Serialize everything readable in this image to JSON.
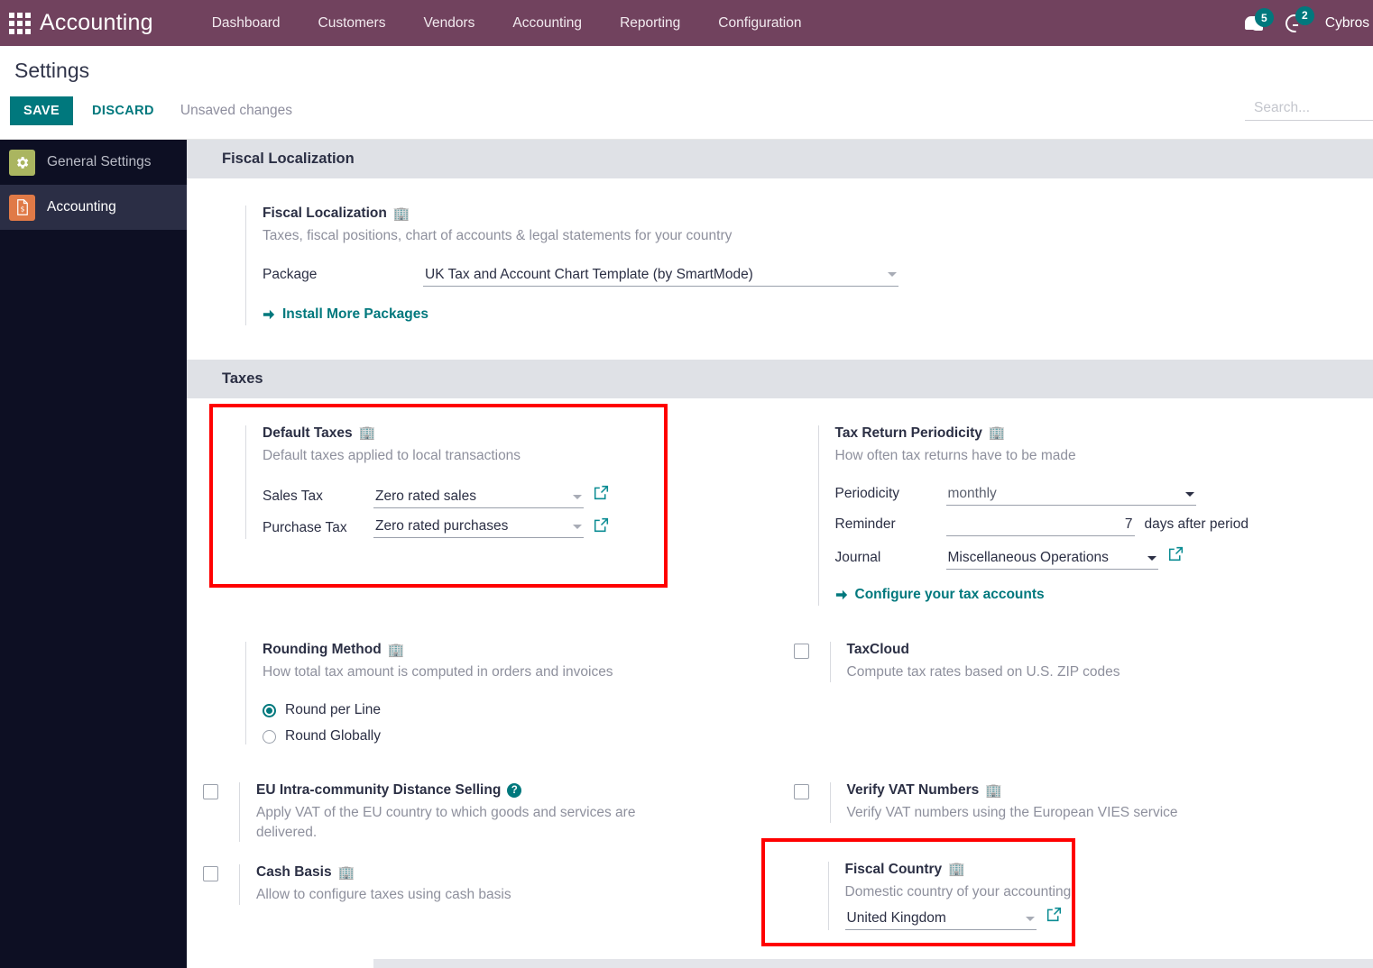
{
  "navbar": {
    "apps_icon": "apps-grid-icon",
    "brand": "Accounting",
    "menu": [
      "Dashboard",
      "Customers",
      "Vendors",
      "Accounting",
      "Reporting",
      "Configuration"
    ],
    "messages_badge": "5",
    "activities_badge": "2",
    "username": "Cybros"
  },
  "control_panel": {
    "breadcrumb": "Settings",
    "save_label": "SAVE",
    "discard_label": "DISCARD",
    "status": "Unsaved changes",
    "search_placeholder": "Search..."
  },
  "sidebar": {
    "items": [
      {
        "label": "General Settings",
        "icon": "gear-icon",
        "active": false
      },
      {
        "label": "Accounting",
        "icon": "document-dollar-icon",
        "active": true
      }
    ]
  },
  "sections": {
    "fiscal_localization": {
      "heading": "Fiscal Localization",
      "title": "Fiscal Localization",
      "description": "Taxes, fiscal positions, chart of accounts & legal statements for your country",
      "package_label": "Package",
      "package_value": "UK Tax and Account Chart Template (by SmartMode)",
      "install_link": "Install More Packages"
    },
    "taxes": {
      "heading": "Taxes",
      "default_taxes": {
        "title": "Default Taxes",
        "description": "Default taxes applied to local transactions",
        "sales_label": "Sales Tax",
        "sales_value": "Zero rated sales",
        "purchase_label": "Purchase Tax",
        "purchase_value": "Zero rated purchases"
      },
      "tax_return_periodicity": {
        "title": "Tax Return Periodicity",
        "description": "How often tax returns have to be made",
        "periodicity_label": "Periodicity",
        "periodicity_value": "monthly",
        "reminder_label": "Reminder",
        "reminder_value": "7",
        "reminder_suffix": "days after period",
        "journal_label": "Journal",
        "journal_value": "Miscellaneous Operations",
        "configure_link": "Configure your tax accounts"
      },
      "rounding_method": {
        "title": "Rounding Method",
        "description": "How total tax amount is computed in orders and invoices",
        "option_per_line": "Round per Line",
        "option_globally": "Round Globally",
        "selected": "Round per Line"
      },
      "taxcloud": {
        "title": "TaxCloud",
        "description": "Compute tax rates based on U.S. ZIP codes",
        "checked": false
      },
      "eu_distance_selling": {
        "title": "EU Intra-community Distance Selling",
        "description": "Apply VAT of the EU country to which goods and services are delivered.",
        "checked": false
      },
      "verify_vat": {
        "title": "Verify VAT Numbers",
        "description": "Verify VAT numbers using the European VIES service",
        "checked": false
      },
      "cash_basis": {
        "title": "Cash Basis",
        "description": "Allow to configure taxes using cash basis",
        "checked": false
      },
      "fiscal_country": {
        "title": "Fiscal Country",
        "description": "Domestic country of your accounting",
        "value": "United Kingdom"
      }
    }
  },
  "colors": {
    "navbar": "#71425e",
    "accent_teal": "#00787d",
    "sidebar": "#0d0f23",
    "sidebar_active": "#2b2e45",
    "section_header": "#dfe1e6",
    "highlight": "#ff0000"
  }
}
